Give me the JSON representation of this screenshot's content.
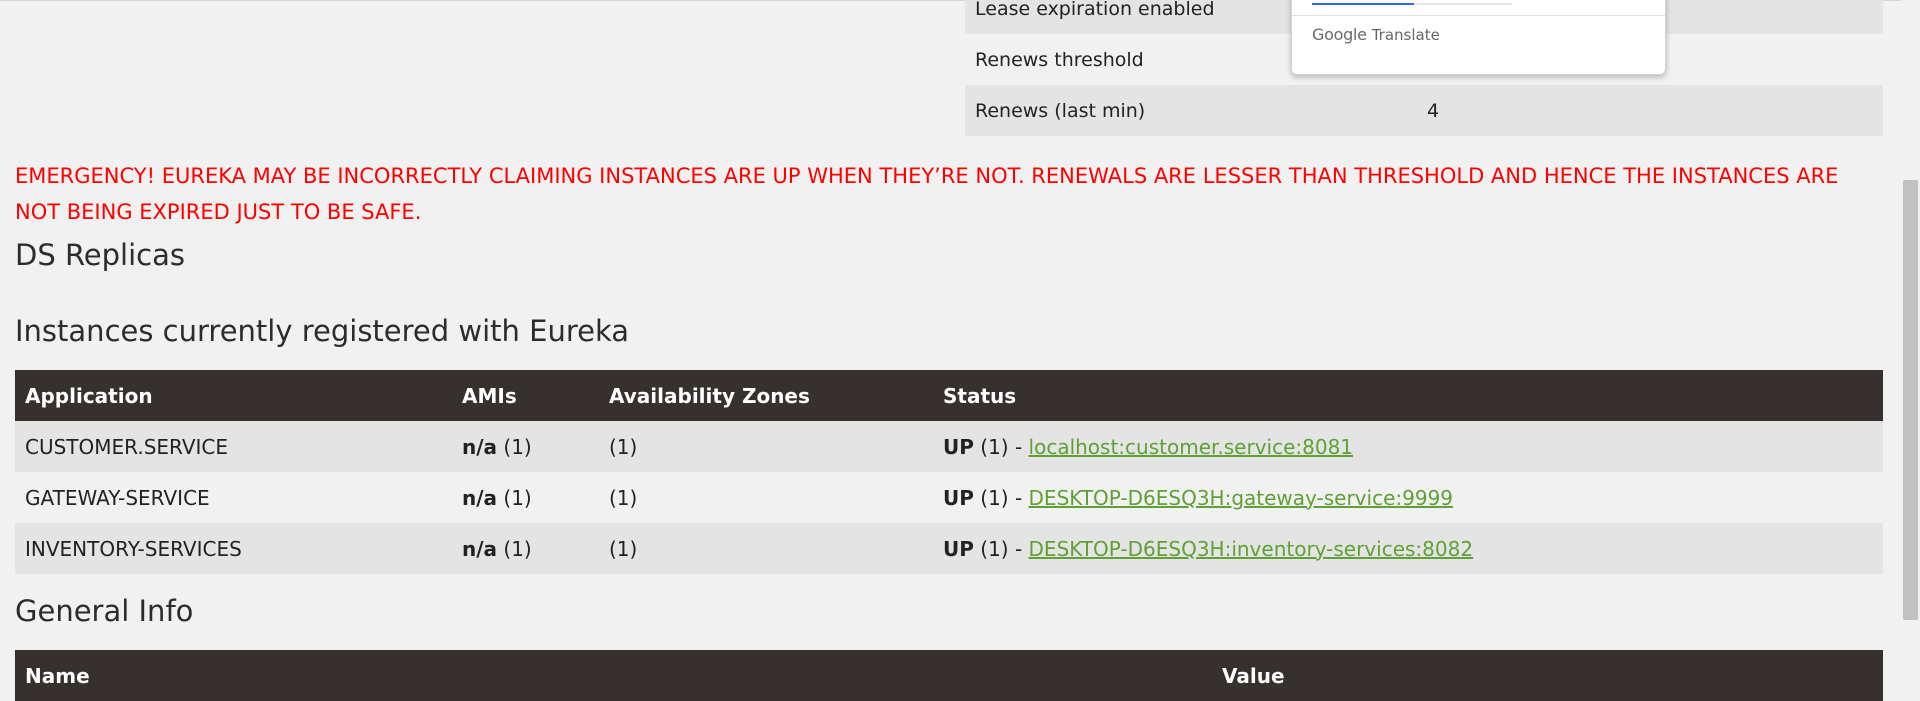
{
  "lease_info": [
    {
      "name": "Lease expiration enabled",
      "value": ""
    },
    {
      "name": "Renews threshold",
      "value": ""
    },
    {
      "name": "Renews (last min)",
      "value": "4"
    }
  ],
  "translate_popup": {
    "brand_google": "Google",
    "brand_translate": "Translate"
  },
  "emergency_message": "EMERGENCY! EUREKA MAY BE INCORRECTLY CLAIMING INSTANCES ARE UP WHEN THEY’RE NOT. RENEWALS ARE LESSER THAN THRESHOLD AND HENCE THE INSTANCES ARE NOT BEING EXPIRED JUST TO BE SAFE.",
  "ds_replicas_title": "DS Replicas",
  "instances": {
    "title": "Instances currently registered with Eureka",
    "headers": [
      "Application",
      "AMIs",
      "Availability Zones",
      "Status"
    ],
    "rows": [
      {
        "application": "CUSTOMER.SERVICE",
        "ami_bold": "n/a",
        "ami_count": " (1)",
        "zones": "(1)",
        "status_bold": "UP",
        "status_count": " (1) - ",
        "link": "localhost:customer.service:8081"
      },
      {
        "application": "GATEWAY-SERVICE",
        "ami_bold": "n/a",
        "ami_count": " (1)",
        "zones": "(1)",
        "status_bold": "UP",
        "status_count": " (1) - ",
        "link": "DESKTOP-D6ESQ3H:gateway-service:9999"
      },
      {
        "application": "INVENTORY-SERVICES",
        "ami_bold": "n/a",
        "ami_count": " (1)",
        "zones": "(1)",
        "status_bold": "UP",
        "status_count": " (1) - ",
        "link": "DESKTOP-D6ESQ3H:inventory-services:8082"
      }
    ]
  },
  "general_info": {
    "title": "General Info",
    "headers": [
      "Name",
      "Value"
    ]
  },
  "colors": {
    "emergency": "#ff0000",
    "header_bg": "#36312e",
    "link": "#5fa134"
  }
}
